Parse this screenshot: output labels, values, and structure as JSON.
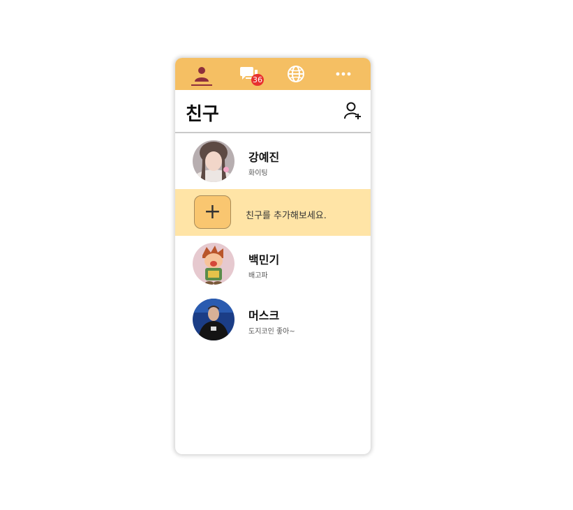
{
  "nav": {
    "tabs": [
      {
        "name": "friends",
        "icon": "person-icon",
        "active": true
      },
      {
        "name": "chats",
        "icon": "chat-icon",
        "badge": "36"
      },
      {
        "name": "open-chat",
        "icon": "globe-icon"
      },
      {
        "name": "more",
        "icon": "more-icon"
      }
    ]
  },
  "header": {
    "title": "친구",
    "add_friend_icon": "add-person-icon"
  },
  "friends": [
    {
      "name": "강예진",
      "status": "화이팅"
    },
    {
      "name": "백민기",
      "status": "배고파"
    },
    {
      "name": "머스크",
      "status": "도지코인 좋아~"
    }
  ],
  "add_friend": {
    "label": "친구를 추가해보세요.",
    "icon": "plus-icon",
    "symbol": "+"
  },
  "colors": {
    "topbar": "#f5bf63",
    "active_tab": "#8e2f3c",
    "badge": "#e8312f",
    "add_row": "#ffe4a6"
  }
}
